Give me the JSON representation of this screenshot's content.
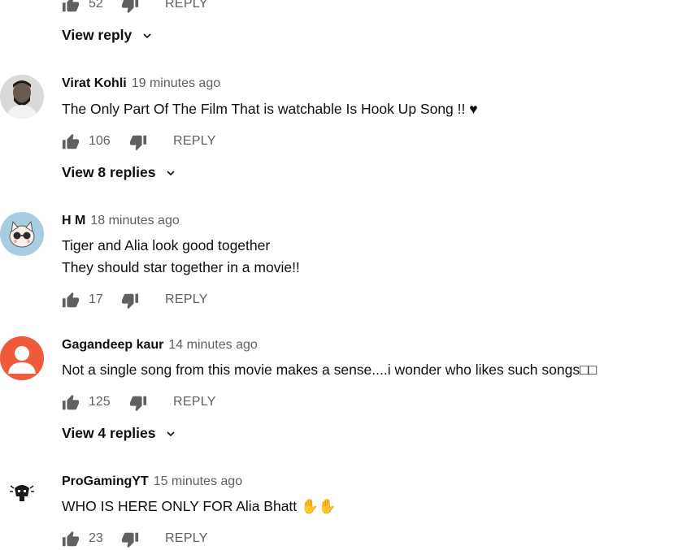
{
  "top_actions": {
    "likes": "52",
    "reply_label": "REPLY"
  },
  "top_view_replies": "View reply",
  "comments": [
    {
      "author": "Virat Kohli",
      "time": "19 minutes ago",
      "lines": [
        "The Only Part Of The Film That is watchable Is Hook Up Song !! ♥"
      ],
      "likes": "106",
      "reply_label": "REPLY",
      "view_replies": "View 8 replies"
    },
    {
      "author": "H M",
      "time": "18 minutes ago",
      "lines": [
        "Tiger and Alia look good together",
        "They should star together in a movie!!"
      ],
      "likes": "17",
      "reply_label": "REPLY",
      "view_replies": ""
    },
    {
      "author": "Gagandeep kaur",
      "time": "14 minutes ago",
      "lines": [
        "Not a single song from this movie makes a sense....i wonder who likes such songs□□"
      ],
      "likes": "125",
      "reply_label": "REPLY",
      "view_replies": "View 4 replies"
    },
    {
      "author": "ProGamingYT",
      "time": "15 minutes ago",
      "lines": [
        "WHO IS HERE ONLY FOR Alia Bhatt ✋✋"
      ],
      "likes": "23",
      "reply_label": "REPLY",
      "view_replies": ""
    }
  ],
  "colors": {
    "text": "#0f0f0f",
    "secondary": "#606060",
    "icon": "#606060",
    "avatar_orange": "#ef5a3a",
    "avatar_blue": "#a8cde0"
  }
}
